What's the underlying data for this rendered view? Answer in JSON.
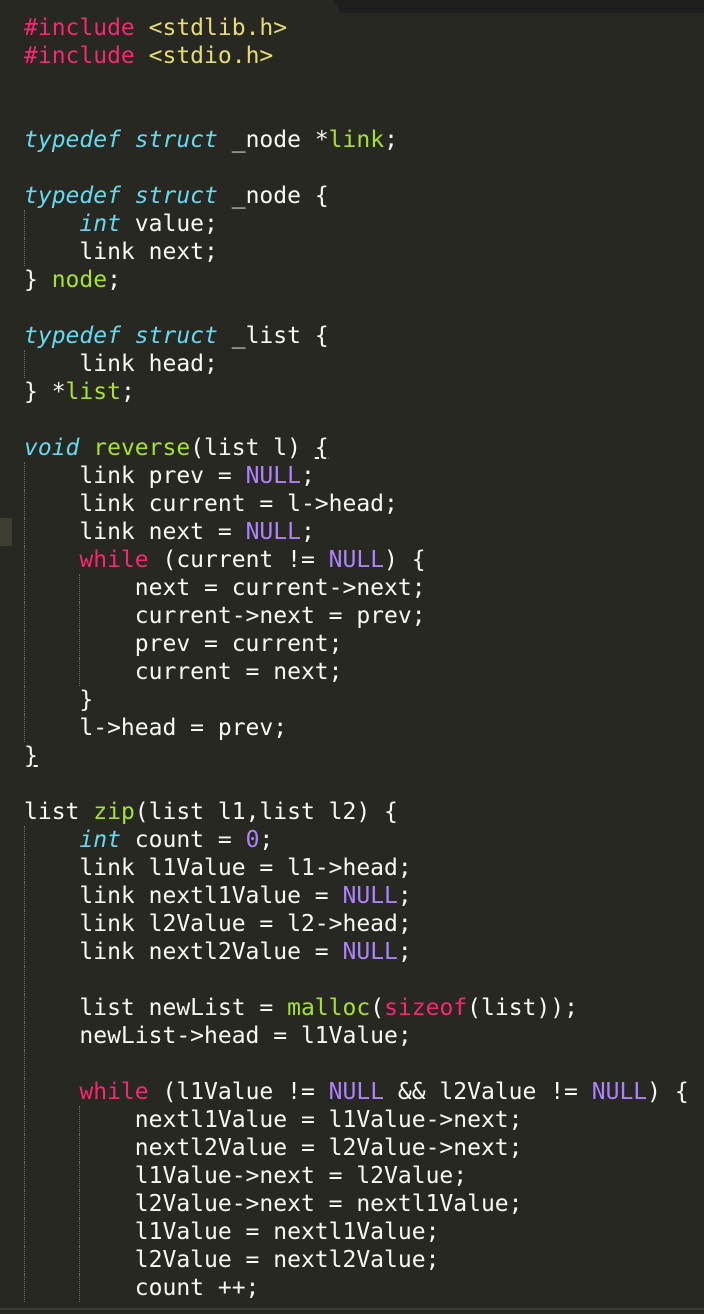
{
  "editor": {
    "theme": "monokai",
    "colors": {
      "background": "#272822",
      "plain": "#f8f8f2",
      "keyword": "#f92672",
      "string": "#e6db74",
      "storage_type": "#66d9ef",
      "function": "#a6e22e",
      "constant": "#ae81ff",
      "indent_guide": "#6f6e66"
    },
    "current_line": 19,
    "lines": [
      {
        "tokens": [
          {
            "t": "#include",
            "c": "kw"
          },
          {
            "t": " "
          },
          {
            "t": "<stdlib.h>",
            "c": "str"
          }
        ]
      },
      {
        "tokens": [
          {
            "t": "#include",
            "c": "kw"
          },
          {
            "t": " "
          },
          {
            "t": "<stdio.h>",
            "c": "str"
          }
        ]
      },
      {
        "tokens": []
      },
      {
        "tokens": []
      },
      {
        "tokens": [
          {
            "t": "typedef",
            "c": "type"
          },
          {
            "t": " "
          },
          {
            "t": "struct",
            "c": "type"
          },
          {
            "t": " _node *"
          },
          {
            "t": "link",
            "c": "fn"
          },
          {
            "t": ";"
          }
        ]
      },
      {
        "tokens": []
      },
      {
        "tokens": [
          {
            "t": "typedef",
            "c": "type"
          },
          {
            "t": " "
          },
          {
            "t": "struct",
            "c": "type"
          },
          {
            "t": " _node {"
          }
        ]
      },
      {
        "tokens": [
          {
            "t": "    "
          },
          {
            "t": "int",
            "c": "type"
          },
          {
            "t": " value;"
          }
        ]
      },
      {
        "tokens": [
          {
            "t": "    link next;"
          }
        ]
      },
      {
        "tokens": [
          {
            "t": "} "
          },
          {
            "t": "node",
            "c": "fn"
          },
          {
            "t": ";"
          }
        ]
      },
      {
        "tokens": []
      },
      {
        "tokens": [
          {
            "t": "typedef",
            "c": "type"
          },
          {
            "t": " "
          },
          {
            "t": "struct",
            "c": "type"
          },
          {
            "t": " _list {"
          }
        ]
      },
      {
        "tokens": [
          {
            "t": "    link head;"
          }
        ]
      },
      {
        "tokens": [
          {
            "t": "} *"
          },
          {
            "t": "list",
            "c": "fn"
          },
          {
            "t": ";"
          }
        ]
      },
      {
        "tokens": []
      },
      {
        "tokens": [
          {
            "t": "void",
            "c": "type"
          },
          {
            "t": " "
          },
          {
            "t": "reverse",
            "c": "fn"
          },
          {
            "t": "(list l) "
          },
          {
            "t": "{",
            "c": "ul"
          }
        ]
      },
      {
        "tokens": [
          {
            "t": "    link prev = "
          },
          {
            "t": "NULL",
            "c": "num"
          },
          {
            "t": ";"
          }
        ]
      },
      {
        "tokens": [
          {
            "t": "    link current = l->head;"
          }
        ]
      },
      {
        "tokens": [
          {
            "t": "    link next = "
          },
          {
            "t": "NULL",
            "c": "num"
          },
          {
            "t": ";"
          }
        ]
      },
      {
        "tokens": [
          {
            "t": "    "
          },
          {
            "t": "while",
            "c": "kw"
          },
          {
            "t": " (current != "
          },
          {
            "t": "NULL",
            "c": "num"
          },
          {
            "t": ") {"
          }
        ]
      },
      {
        "tokens": [
          {
            "t": "        next = current->next;"
          }
        ]
      },
      {
        "tokens": [
          {
            "t": "        current->next = prev;"
          }
        ]
      },
      {
        "tokens": [
          {
            "t": "        prev = current;"
          }
        ]
      },
      {
        "tokens": [
          {
            "t": "        current = next;"
          }
        ]
      },
      {
        "tokens": [
          {
            "t": "    }"
          }
        ]
      },
      {
        "tokens": [
          {
            "t": "    l->head = prev;"
          }
        ]
      },
      {
        "tokens": [
          {
            "t": "}",
            "c": "ul"
          }
        ]
      },
      {
        "tokens": []
      },
      {
        "tokens": [
          {
            "t": "list "
          },
          {
            "t": "zip",
            "c": "fn"
          },
          {
            "t": "(list l1,list l2) {"
          }
        ]
      },
      {
        "tokens": [
          {
            "t": "    "
          },
          {
            "t": "int",
            "c": "type"
          },
          {
            "t": " count = "
          },
          {
            "t": "0",
            "c": "num"
          },
          {
            "t": ";"
          }
        ]
      },
      {
        "tokens": [
          {
            "t": "    link l1Value = l1->head;"
          }
        ]
      },
      {
        "tokens": [
          {
            "t": "    link nextl1Value = "
          },
          {
            "t": "NULL",
            "c": "num"
          },
          {
            "t": ";"
          }
        ]
      },
      {
        "tokens": [
          {
            "t": "    link l2Value = l2->head;"
          }
        ]
      },
      {
        "tokens": [
          {
            "t": "    link nextl2Value = "
          },
          {
            "t": "NULL",
            "c": "num"
          },
          {
            "t": ";"
          }
        ]
      },
      {
        "tokens": []
      },
      {
        "tokens": [
          {
            "t": "    list newList = "
          },
          {
            "t": "malloc",
            "c": "fn"
          },
          {
            "t": "("
          },
          {
            "t": "sizeof",
            "c": "kw"
          },
          {
            "t": "(list));"
          }
        ]
      },
      {
        "tokens": [
          {
            "t": "    newList->head = l1Value;"
          }
        ]
      },
      {
        "tokens": []
      },
      {
        "tokens": [
          {
            "t": "    "
          },
          {
            "t": "while",
            "c": "kw"
          },
          {
            "t": " (l1Value != "
          },
          {
            "t": "NULL",
            "c": "num"
          },
          {
            "t": " && l2Value != "
          },
          {
            "t": "NULL",
            "c": "num"
          },
          {
            "t": ") {"
          }
        ]
      },
      {
        "tokens": [
          {
            "t": "        nextl1Value = l1Value->next;"
          }
        ]
      },
      {
        "tokens": [
          {
            "t": "        nextl2Value = l2Value->next;"
          }
        ]
      },
      {
        "tokens": [
          {
            "t": "        l1Value->next = l2Value;"
          }
        ]
      },
      {
        "tokens": [
          {
            "t": "        l2Value->next = nextl1Value;"
          }
        ]
      },
      {
        "tokens": [
          {
            "t": "        l1Value = nextl1Value;"
          }
        ]
      },
      {
        "tokens": [
          {
            "t": "        l2Value = nextl2Value;"
          }
        ]
      },
      {
        "tokens": [
          {
            "t": "        count ++;"
          }
        ]
      }
    ]
  }
}
